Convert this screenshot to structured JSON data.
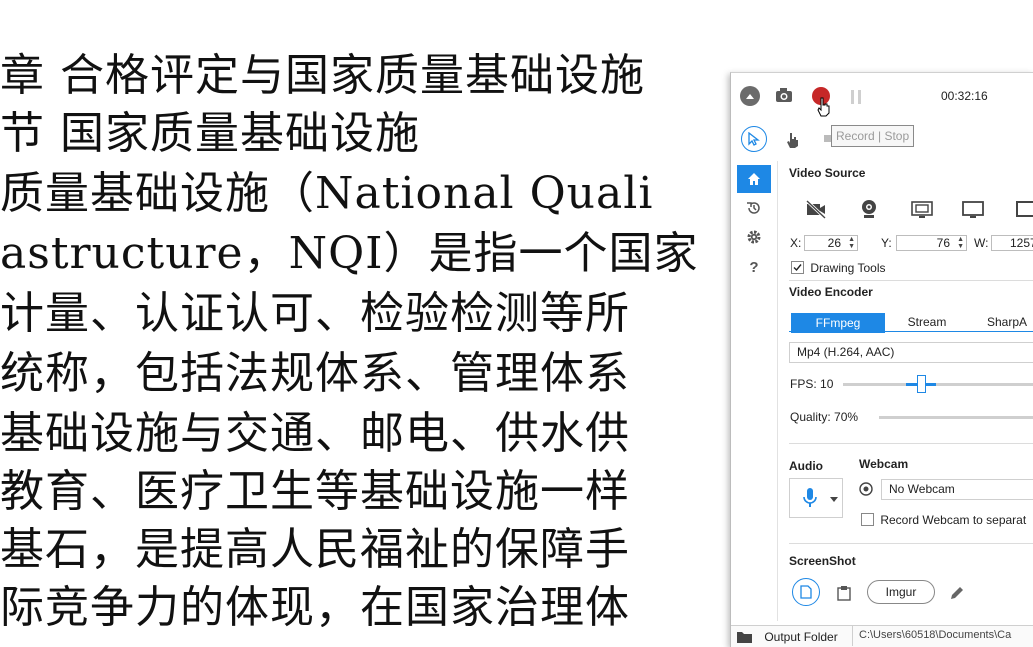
{
  "document": {
    "lines": [
      "章 合格评定与国家质量基础设施",
      "节 国家质量基础设施",
      "质量基础设施（National Quali",
      "astructure，NQI）是指一个国家",
      "计量、认证认可、检验检测等所",
      "统称，包括法规体系、管理体系",
      "基础设施与交通、邮电、供水供",
      "教育、医疗卫生等基础设施一样",
      "基石，是提高人民福祉的保障手",
      "际竞争力的体现，在国家治理体"
    ]
  },
  "recorder": {
    "timer": "00:32:16",
    "record_tooltip": "Record | Stop",
    "video_source": {
      "title": "Video Source",
      "x_label": "X:",
      "x_value": "26",
      "y_label": "Y:",
      "y_value": "76",
      "w_label": "W:",
      "w_value": "1257",
      "drawing_tools_label": "Drawing Tools",
      "drawing_tools_checked": true
    },
    "video_encoder": {
      "title": "Video Encoder",
      "tabs": [
        "FFmpeg",
        "Stream",
        "SharpA"
      ],
      "active_tab": "FFmpeg",
      "format": "Mp4 (H.264, AAC)",
      "fps_label": "FPS:",
      "fps_value": "10",
      "quality_label": "Quality:",
      "quality_value": "70%"
    },
    "audio": {
      "title": "Audio"
    },
    "webcam": {
      "title": "Webcam",
      "selected": "No Webcam",
      "record_separately_label": "Record Webcam to separat"
    },
    "screenshot": {
      "title": "ScreenShot",
      "imgur_label": "Imgur"
    },
    "output": {
      "label": "Output Folder",
      "path": "C:\\Users\\60518\\Documents\\Ca"
    },
    "colors": {
      "accent": "#1e88e5",
      "record": "#c62828"
    }
  }
}
